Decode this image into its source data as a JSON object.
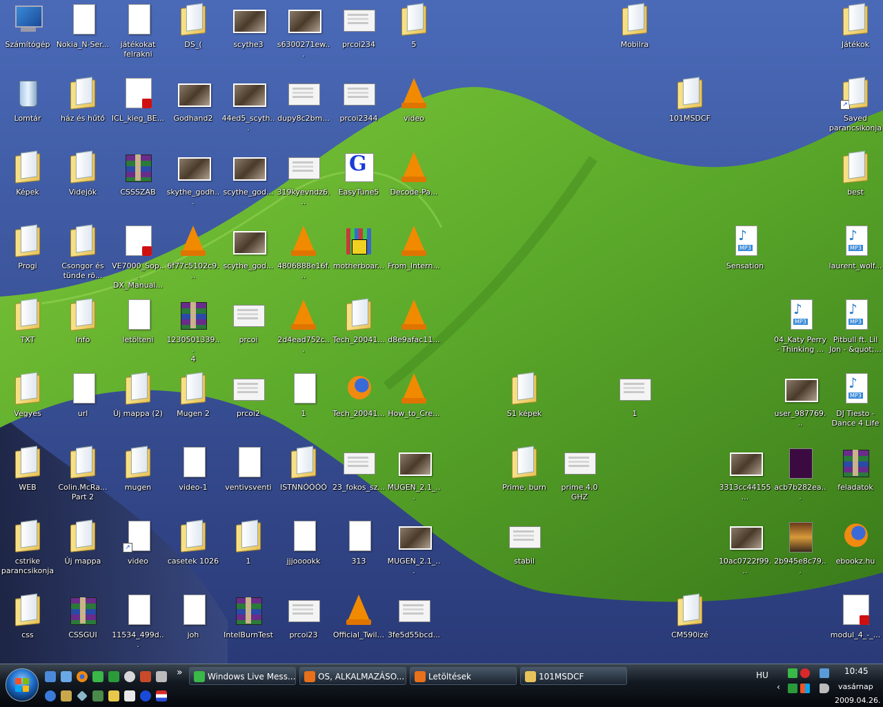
{
  "desktop_icons": [
    {
      "label": "Számítógép",
      "type": "computer"
    },
    {
      "label": "Nokia_N-Ser...",
      "type": "doc"
    },
    {
      "label": "játékokat\nfelrakni",
      "type": "doc"
    },
    {
      "label": "DS_(",
      "type": "folder"
    },
    {
      "label": "scythe3",
      "type": "img"
    },
    {
      "label": "s6300271ew...",
      "type": "img"
    },
    {
      "label": "prcoi234",
      "type": "shot"
    },
    {
      "label": "5",
      "type": "folder"
    },
    {
      "label": "Mobilra",
      "type": "folder"
    },
    {
      "label": "Játékok",
      "type": "folder"
    },
    {
      "label": "Lomtár",
      "type": "bin"
    },
    {
      "label": "ház és hűtő",
      "type": "folder"
    },
    {
      "label": "ICL_kieg_BE...",
      "type": "pdf"
    },
    {
      "label": "Godhand2",
      "type": "img"
    },
    {
      "label": "44ed5_scyth...",
      "type": "img"
    },
    {
      "label": "dupy8c2bm...",
      "type": "shot"
    },
    {
      "label": "prcoi2344",
      "type": "shot"
    },
    {
      "label": "video",
      "type": "vlc"
    },
    {
      "label": "101MSDCF",
      "type": "folder"
    },
    {
      "label": "Saved\nparancsikonja",
      "type": "folder"
    },
    {
      "label": "Képek",
      "type": "folder"
    },
    {
      "label": "Videjók",
      "type": "folder"
    },
    {
      "label": "CSSSZAB",
      "type": "rar"
    },
    {
      "label": "skythe_godh...",
      "type": "img"
    },
    {
      "label": "scythe_god...",
      "type": "img"
    },
    {
      "label": "319kyevndz6...",
      "type": "shot"
    },
    {
      "label": "EasyTune5",
      "type": "gb"
    },
    {
      "label": "Decode-Pa...",
      "type": "vlc"
    },
    {
      "label": "best",
      "type": "folder"
    },
    {
      "label": "Progi",
      "type": "folder"
    },
    {
      "label": "Csongor és\ntünde rö...",
      "type": "folder"
    },
    {
      "label": "VE7000_Sop...\nDX_Manual...",
      "type": "pdf"
    },
    {
      "label": "6f77c5102c9...",
      "type": "vlc"
    },
    {
      "label": "scythe_god...",
      "type": "img"
    },
    {
      "label": "4806888e16f...",
      "type": "vlc"
    },
    {
      "label": "motherboar...",
      "type": "inst"
    },
    {
      "label": "From_Intern...",
      "type": "vlc"
    },
    {
      "label": "Sensation",
      "type": "mp3"
    },
    {
      "label": "laurent_wolf...",
      "type": "mp3"
    },
    {
      "label": "TXT",
      "type": "folder"
    },
    {
      "label": "Info",
      "type": "folder"
    },
    {
      "label": "letölteni",
      "type": "doc"
    },
    {
      "label": "1230501339...\n4",
      "type": "rar"
    },
    {
      "label": "prcoi",
      "type": "shot"
    },
    {
      "label": "2d4ead752c...",
      "type": "vlc"
    },
    {
      "label": "Tech_20041...",
      "type": "folder"
    },
    {
      "label": "d8e9afac11...",
      "type": "vlc"
    },
    {
      "label": "04_Katy Perry\n- Thinking ...",
      "type": "mp3"
    },
    {
      "label": "Pitbull ft. Lil\nJon - &quot;...",
      "type": "mp3"
    },
    {
      "label": "Vegyes",
      "type": "folder"
    },
    {
      "label": "url",
      "type": "doc"
    },
    {
      "label": "Új mappa (2)",
      "type": "folder"
    },
    {
      "label": "Mugen 2",
      "type": "folder"
    },
    {
      "label": "prcoi2",
      "type": "shot"
    },
    {
      "label": "1",
      "type": "doc"
    },
    {
      "label": "Tech_20041...",
      "type": "ff"
    },
    {
      "label": "How_to_Cre...",
      "type": "vlc"
    },
    {
      "label": "S1 képek",
      "type": "folder"
    },
    {
      "label": "1",
      "type": "shot"
    },
    {
      "label": "user_987769...",
      "type": "img"
    },
    {
      "label": "DJ Tiesto -\nDance 4 Life",
      "type": "mp3"
    },
    {
      "label": "WEB",
      "type": "folder"
    },
    {
      "label": "Colin.McRa...\nPart 2",
      "type": "folder"
    },
    {
      "label": "mugen",
      "type": "folder"
    },
    {
      "label": "video-1",
      "type": "doc"
    },
    {
      "label": "ventivsventi",
      "type": "doc"
    },
    {
      "label": "ISTNNÓÓÓÓ",
      "type": "folder"
    },
    {
      "label": "23_fokos_sz...",
      "type": "shot"
    },
    {
      "label": "MUGEN_2.1_...",
      "type": "img"
    },
    {
      "label": "Prime, burn",
      "type": "folder"
    },
    {
      "label": "prime 4.0 GHZ",
      "type": "shot"
    },
    {
      "label": "3313cc44155...",
      "type": "img"
    },
    {
      "label": "acb7b282ea...",
      "type": "dark"
    },
    {
      "label": "feladatok",
      "type": "rar"
    },
    {
      "label": "cstrike\nparancsikonja",
      "type": "folder"
    },
    {
      "label": "Új mappa",
      "type": "folder"
    },
    {
      "label": "video",
      "type": "doc"
    },
    {
      "label": "casetek 1026",
      "type": "folder"
    },
    {
      "label": "1",
      "type": "folder"
    },
    {
      "label": "jjjooookk",
      "type": "doc"
    },
    {
      "label": "313",
      "type": "doc"
    },
    {
      "label": "MUGEN_2.1_...",
      "type": "img"
    },
    {
      "label": "stabil",
      "type": "shot"
    },
    {
      "label": "10ac0722f99...",
      "type": "img"
    },
    {
      "label": "2b945e8c79...",
      "type": "portrait"
    },
    {
      "label": "ebookz.hu",
      "type": "ff"
    },
    {
      "label": "css",
      "type": "folder"
    },
    {
      "label": "CSSGUI",
      "type": "rar"
    },
    {
      "label": "11534_499d...",
      "type": "doc"
    },
    {
      "label": "joh",
      "type": "doc"
    },
    {
      "label": "IntelBurnTest",
      "type": "rar"
    },
    {
      "label": "prcoi23",
      "type": "shot"
    },
    {
      "label": "Official_Twil...",
      "type": "vlc"
    },
    {
      "label": "3fe5d55bcd...",
      "type": "shot"
    },
    {
      "label": "CM590izé",
      "type": "folder"
    },
    {
      "label": "modul_4_-_...",
      "type": "pdf"
    }
  ],
  "taskbar": {
    "quicklaunch_more": "»",
    "tasks": [
      {
        "label": "Windows Live Mess...",
        "icon": "messenger-icon",
        "color": "#3ab848"
      },
      {
        "label": "OS, ALKALMAZÁSO...",
        "icon": "firefox-icon",
        "color": "#e8701a"
      },
      {
        "label": "Letöltések",
        "icon": "firefox-icon",
        "color": "#e8701a"
      },
      {
        "label": "101MSDCF",
        "icon": "folder-icon",
        "color": "#e9c35a"
      }
    ],
    "language": "HU",
    "time": "10:45",
    "day": "vasárnap",
    "date": "2009.04.26."
  }
}
